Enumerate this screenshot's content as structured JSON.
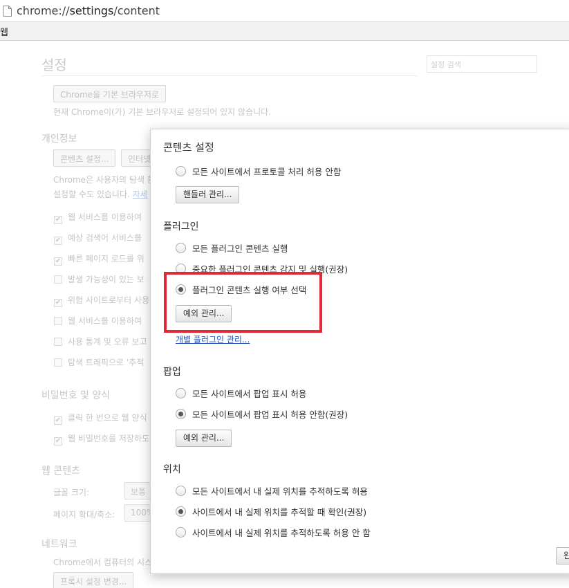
{
  "browser": {
    "url_scheme": "chrome://",
    "url_host": "settings",
    "url_path": "/content",
    "bookmark_item": "웹"
  },
  "background": {
    "title": "설정",
    "search_placeholder": "설정 검색",
    "default_browser_button": "Chrome을 기본 브라우저로",
    "default_browser_note": "현재 Chrome이(가) 기본 브라우저로 설정되어 있지 않습니다.",
    "privacy_heading": "개인정보",
    "content_settings_button": "콘텐츠 설정...",
    "clear_data_button": "인터넷",
    "privacy_text_1": "Chrome은 사용자의 탐색 환",
    "privacy_text_2": "설정할 수도 있습니다.",
    "privacy_link": "자세",
    "checkboxes": [
      {
        "label": "웹 서비스를 이용하여",
        "checked": true
      },
      {
        "label": "예상 검색어 서비스를",
        "checked": true
      },
      {
        "label": "빠른 페이지 로드를 위",
        "checked": true
      },
      {
        "label": "발생 가능성이 있는 보",
        "checked": false
      },
      {
        "label": "위험 사이트로부터 사용",
        "checked": true
      },
      {
        "label": "웹 서비스를 이용하여",
        "checked": false
      },
      {
        "label": "사용 통계 및 오류 보고",
        "checked": false
      },
      {
        "label": "탐색 트래픽으로 '추적",
        "checked": false
      }
    ],
    "passwords_heading": "비밀번호 및 양식",
    "password_checkboxes": [
      {
        "label": "클릭 한 번으로 웹 양식",
        "checked": true
      },
      {
        "label": "웹 비밀번호를 저장하도",
        "checked": true
      }
    ],
    "web_content_heading": "웹 콘텐츠",
    "font_size_label": "글꼴 크기:",
    "font_size_value": "보통",
    "zoom_label": "페이지 확대/축소:",
    "zoom_value": "100%",
    "network_heading": "네트워크",
    "network_text": "Chrome에서 컴퓨터의 시스",
    "proxy_button": "프록시 설정 변경..."
  },
  "dialog": {
    "title": "콘텐츠 설정",
    "protocol": {
      "radio_label": "모든 사이트에서 프로토콜 처리 허용 안함",
      "button": "핸들러 관리..."
    },
    "plugins": {
      "heading": "플러그인",
      "options": [
        {
          "label": "모든 플러그인 콘텐츠 실행",
          "checked": false
        },
        {
          "label": "중요한 플러그인 콘텐츠 감지 및 실행(권장)",
          "checked": false
        },
        {
          "label": "플러그인 콘텐츠 실행 여부 선택",
          "checked": true
        }
      ],
      "exceptions_button": "예외 관리...",
      "individual_link": "개별 플러그인 관리..."
    },
    "popups": {
      "heading": "팝업",
      "options": [
        {
          "label": "모든 사이트에서 팝업 표시 허용",
          "checked": false
        },
        {
          "label": "모든 사이트에서 팝업 표시 허용 안함(권장)",
          "checked": true
        }
      ],
      "exceptions_button": "예외 관리..."
    },
    "location": {
      "heading": "위치",
      "options": [
        {
          "label": "모든 사이트에서 내 실제 위치를 추적하도록 허용",
          "checked": false
        },
        {
          "label": "사이트에서 내 실제 위치를 추적할 때 확인(권장)",
          "checked": true
        },
        {
          "label": "사이트에서 내 실제 위치를 추적하도록 허용 안 함",
          "checked": false
        }
      ]
    },
    "done_button": "완"
  },
  "colors": {
    "highlight": "#dd2b37",
    "link": "#2255bb"
  }
}
